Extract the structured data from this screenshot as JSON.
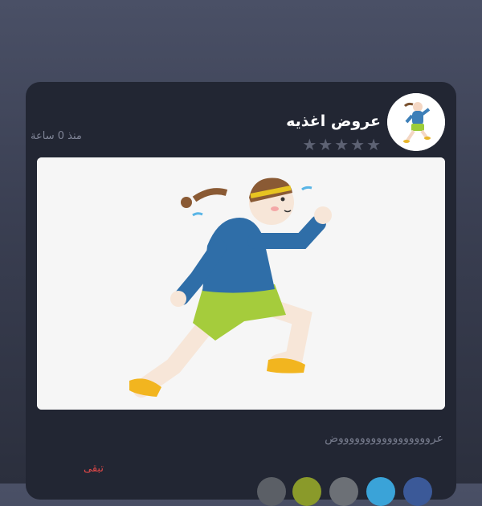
{
  "post": {
    "title": "عروض اغذيه",
    "rating": 0,
    "stars_max": 5,
    "time_ago": "منذ 0 ساعة",
    "description": "عروووووووووووووووووض",
    "remaining_label": "تبقى"
  },
  "colors": {
    "star_empty": "#5d6273",
    "remaining": "#e04848",
    "share_buttons": [
      "#5b5f66",
      "#8a9a2a",
      "#6c7076",
      "#3aa3d8",
      "#3b5998"
    ]
  },
  "icons": {
    "avatar": "running-woman-icon",
    "star": "star-icon"
  }
}
